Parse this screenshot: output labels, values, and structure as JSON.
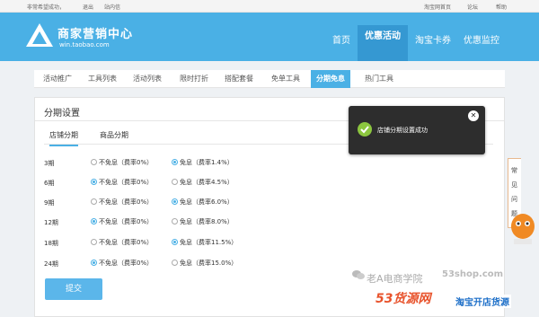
{
  "topbar": {
    "welcome": "非常希望成功，",
    "logout": "退出",
    "messages": "站内信",
    "taobao_home": "淘宝网首页",
    "forum": "论坛",
    "help": "帮助"
  },
  "header": {
    "logo_title": "商家营销中心",
    "logo_sub": "win.taobao.com",
    "nav": [
      "首页",
      "优惠活动",
      "淘宝卡券",
      "优惠监控"
    ],
    "active_nav": "优惠活动"
  },
  "tabs": [
    "活动推广",
    "工具列表",
    "活动列表",
    "限时打折",
    "搭配套餐",
    "免单工具",
    "分期免息",
    "热门工具"
  ],
  "active_tab": "分期免息",
  "panel": {
    "title": "分期设置",
    "subtabs": [
      "店铺分期",
      "商品分期"
    ],
    "active_subtab": "店铺分期",
    "rows": [
      {
        "period": "3期",
        "opt_a": "不免息（费率0%）",
        "opt_b": "免息（费率1.4%）",
        "selected": "b"
      },
      {
        "period": "6期",
        "opt_a": "不免息（费率0%）",
        "opt_b": "免息（费率4.5%）",
        "selected": "a"
      },
      {
        "period": "9期",
        "opt_a": "不免息（费率0%）",
        "opt_b": "免息（费率6.0%）",
        "selected": "b"
      },
      {
        "period": "12期",
        "opt_a": "不免息（费率0%）",
        "opt_b": "免息（费率8.0%）",
        "selected": "a"
      },
      {
        "period": "18期",
        "opt_a": "不免息（费率0%）",
        "opt_b": "免息（费率11.5%）",
        "selected": "b"
      },
      {
        "period": "24期",
        "opt_a": "不免息（费率0%）",
        "opt_b": "免息（费率15.0%）",
        "selected": "a"
      }
    ],
    "submit_label": "提交"
  },
  "toast": {
    "message": "店铺分期设置成功",
    "close_glyph": "✕"
  },
  "faq": [
    "常",
    "见",
    "问",
    "题"
  ],
  "watermark": {
    "author": "老A电商学院",
    "site": "53shop.com",
    "brand": "53货源网",
    "slogan": "淘宝开店货源"
  },
  "colors": {
    "header": "#4ab0e5",
    "nav_active": "#3598d2",
    "accent": "#4ab0e5",
    "toast_bg": "#2d2d2d",
    "success": "#8cc63f",
    "brand_red": "#e8532c"
  }
}
